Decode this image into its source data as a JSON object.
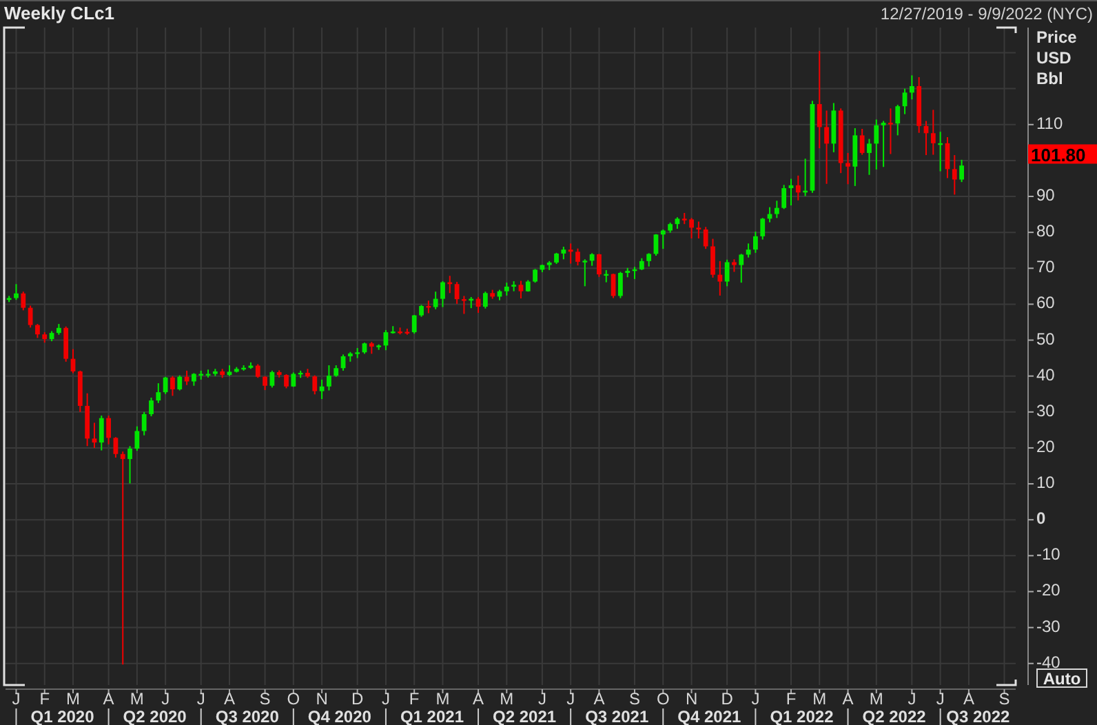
{
  "header": {
    "title": "Weekly CLc1",
    "date_range": "12/27/2019 - 9/9/2022 (NYC)"
  },
  "chart": {
    "auto_button": {
      "label": "Auto"
    },
    "quarters": [
      {
        "label": "Q1 2020"
      },
      {
        "label": "Q2 2020"
      },
      {
        "label": "Q3 2020"
      },
      {
        "label": "Q4 2020"
      },
      {
        "label": "Q1 2021"
      },
      {
        "label": "Q2 2021"
      },
      {
        "label": "Q3 2021"
      },
      {
        "label": "Q4 2021"
      },
      {
        "label": "Q1 2022"
      },
      {
        "label": "Q2 2022"
      },
      {
        "label": "Q3 2022"
      }
    ],
    "chart_data": {
      "type": "candlestick",
      "ylabel": "Price USD Bbl",
      "grid": true,
      "ylim": [
        -46,
        137
      ],
      "yticks": [
        {
          "value": -40,
          "label": "-40"
        },
        {
          "value": -30,
          "label": "-30"
        },
        {
          "value": -20,
          "label": "-20"
        },
        {
          "value": -10,
          "label": "-10"
        },
        {
          "value": 0,
          "label": "0"
        },
        {
          "value": 10,
          "label": "10"
        },
        {
          "value": 20,
          "label": "20"
        },
        {
          "value": 30,
          "label": "30"
        },
        {
          "value": 40,
          "label": "40"
        },
        {
          "value": 50,
          "label": "50"
        },
        {
          "value": 60,
          "label": "60"
        },
        {
          "value": 70,
          "label": "70"
        },
        {
          "value": 80,
          "label": "80"
        },
        {
          "value": 90,
          "label": "90"
        },
        {
          "value": 110,
          "label": "110"
        }
      ],
      "annotations": [
        "101.80"
      ],
      "categories": [
        null,
        "J",
        null,
        null,
        null,
        "F",
        null,
        null,
        null,
        "M",
        null,
        null,
        null,
        null,
        "A",
        null,
        null,
        null,
        "M",
        null,
        null,
        null,
        "J",
        null,
        null,
        null,
        null,
        "J",
        null,
        null,
        null,
        "A",
        null,
        null,
        null,
        null,
        "S",
        null,
        null,
        null,
        "O",
        null,
        null,
        null,
        "N",
        null,
        null,
        null,
        null,
        "D",
        null,
        null,
        null,
        "J",
        null,
        null,
        null,
        "F",
        null,
        null,
        null,
        "M",
        null,
        null,
        null,
        null,
        "A",
        null,
        null,
        null,
        "M",
        null,
        null,
        null,
        null,
        "J",
        null,
        null,
        null,
        "J",
        null,
        null,
        null,
        "A",
        null,
        null,
        null,
        null,
        "S",
        null,
        null,
        null,
        "O",
        null,
        null,
        null,
        "N",
        null,
        null,
        null,
        null,
        "D",
        null,
        null,
        null,
        "J",
        null,
        null,
        null,
        null,
        "F",
        null,
        null,
        null,
        "M",
        null,
        null,
        null,
        "A",
        null,
        null,
        null,
        "M",
        null,
        null,
        null,
        null,
        "J",
        null,
        null,
        null,
        "J",
        null,
        null,
        null,
        "A",
        null,
        null,
        null,
        null,
        "S",
        null
      ],
      "ohlc": [
        [
          61.2,
          62.3,
          60.6,
          61.7
        ],
        [
          61.7,
          65.6,
          61.2,
          63.0
        ],
        [
          63.0,
          63.5,
          58.3,
          59.0
        ],
        [
          59.0,
          59.6,
          53.5,
          54.2
        ],
        [
          54.2,
          54.5,
          50.6,
          51.6
        ],
        [
          51.6,
          52.2,
          49.3,
          50.3
        ],
        [
          50.3,
          52.5,
          49.7,
          52.0
        ],
        [
          52.0,
          54.5,
          51.5,
          53.4
        ],
        [
          53.4,
          53.8,
          44.0,
          44.8
        ],
        [
          44.8,
          47.5,
          40.8,
          41.3
        ],
        [
          41.3,
          41.5,
          30.0,
          31.7
        ],
        [
          31.7,
          35.2,
          20.5,
          22.6
        ],
        [
          22.6,
          27.0,
          20.0,
          21.5
        ],
        [
          21.5,
          29.0,
          19.3,
          28.3
        ],
        [
          28.3,
          29.0,
          21.0,
          22.8
        ],
        [
          22.8,
          23.0,
          17.3,
          18.3
        ],
        [
          18.3,
          19.0,
          -40.3,
          16.9
        ],
        [
          16.9,
          20.5,
          10.1,
          19.8
        ],
        [
          19.8,
          26.0,
          19.2,
          24.7
        ],
        [
          24.7,
          30.0,
          23.5,
          29.4
        ],
        [
          29.4,
          34.0,
          28.8,
          33.2
        ],
        [
          33.2,
          38.0,
          32.5,
          35.5
        ],
        [
          35.5,
          39.8,
          35.0,
          39.6
        ],
        [
          39.6,
          40.0,
          34.5,
          36.3
        ],
        [
          36.3,
          40.2,
          36.0,
          39.8
        ],
        [
          39.8,
          41.5,
          37.5,
          38.5
        ],
        [
          38.5,
          40.8,
          37.3,
          40.6
        ],
        [
          40.6,
          41.5,
          39.0,
          40.6
        ],
        [
          40.6,
          41.8,
          39.6,
          40.6
        ],
        [
          40.6,
          42.0,
          40.0,
          41.3
        ],
        [
          41.3,
          42.0,
          39.5,
          40.3
        ],
        [
          40.3,
          43.0,
          40.0,
          41.2
        ],
        [
          41.2,
          42.5,
          41.0,
          42.0
        ],
        [
          42.0,
          43.0,
          41.5,
          42.3
        ],
        [
          42.3,
          43.8,
          42.0,
          42.9
        ],
        [
          42.9,
          43.3,
          39.5,
          39.8
        ],
        [
          39.8,
          40.0,
          36.1,
          37.3
        ],
        [
          37.3,
          41.5,
          36.8,
          41.1
        ],
        [
          41.1,
          41.6,
          39.6,
          40.3
        ],
        [
          40.3,
          40.5,
          36.6,
          37.1
        ],
        [
          37.1,
          41.0,
          37.0,
          40.6
        ],
        [
          40.6,
          41.5,
          39.5,
          40.9
        ],
        [
          40.9,
          42.0,
          39.5,
          39.9
        ],
        [
          39.9,
          40.2,
          34.9,
          35.8
        ],
        [
          35.8,
          39.0,
          33.6,
          37.1
        ],
        [
          37.1,
          43.0,
          36.0,
          40.1
        ],
        [
          40.1,
          43.0,
          39.8,
          42.2
        ],
        [
          42.2,
          46.0,
          41.5,
          45.5
        ],
        [
          45.5,
          46.7,
          44.0,
          46.3
        ],
        [
          46.3,
          47.8,
          45.0,
          46.6
        ],
        [
          46.6,
          49.3,
          46.2,
          49.1
        ],
        [
          49.1,
          49.5,
          46.2,
          48.2
        ],
        [
          48.2,
          48.8,
          47.3,
          48.5
        ],
        [
          48.5,
          52.8,
          47.2,
          52.2
        ],
        [
          52.2,
          53.9,
          51.8,
          52.4
        ],
        [
          52.4,
          53.5,
          51.6,
          52.3
        ],
        [
          52.3,
          53.2,
          51.5,
          52.2
        ],
        [
          52.2,
          57.0,
          51.8,
          56.9
        ],
        [
          56.9,
          59.8,
          56.5,
          59.5
        ],
        [
          59.5,
          61.0,
          57.5,
          59.2
        ],
        [
          59.2,
          63.5,
          58.6,
          61.5
        ],
        [
          61.5,
          66.4,
          59.2,
          66.1
        ],
        [
          66.1,
          67.9,
          63.1,
          65.6
        ],
        [
          65.6,
          66.2,
          60.1,
          61.4
        ],
        [
          61.4,
          62.3,
          57.3,
          61.0
        ],
        [
          61.0,
          62.0,
          58.9,
          61.5
        ],
        [
          61.5,
          62.0,
          57.6,
          59.3
        ],
        [
          59.3,
          63.5,
          58.8,
          63.1
        ],
        [
          63.1,
          64.0,
          61.5,
          62.1
        ],
        [
          62.1,
          64.0,
          61.1,
          63.6
        ],
        [
          63.6,
          66.0,
          62.4,
          64.9
        ],
        [
          64.9,
          66.4,
          63.6,
          65.4
        ],
        [
          65.4,
          66.5,
          61.6,
          63.6
        ],
        [
          63.6,
          66.7,
          63.5,
          66.3
        ],
        [
          66.3,
          69.8,
          66.0,
          69.6
        ],
        [
          69.6,
          71.0,
          68.9,
          70.9
        ],
        [
          70.9,
          72.0,
          69.5,
          71.6
        ],
        [
          71.6,
          74.3,
          71.2,
          74.1
        ],
        [
          74.1,
          76.0,
          72.5,
          75.2
        ],
        [
          75.2,
          76.9,
          71.3,
          74.6
        ],
        [
          74.6,
          75.5,
          70.8,
          71.8
        ],
        [
          71.8,
          72.5,
          65.0,
          72.1
        ],
        [
          72.1,
          74.2,
          70.7,
          73.9
        ],
        [
          73.9,
          74.0,
          67.6,
          68.3
        ],
        [
          68.3,
          69.5,
          66.1,
          68.4
        ],
        [
          68.4,
          68.5,
          61.7,
          62.3
        ],
        [
          62.3,
          69.0,
          61.7,
          68.7
        ],
        [
          68.7,
          70.1,
          67.5,
          69.3
        ],
        [
          69.3,
          70.4,
          67.0,
          69.7
        ],
        [
          69.7,
          72.8,
          69.5,
          72.0
        ],
        [
          72.0,
          74.2,
          70.5,
          74.0
        ],
        [
          74.0,
          79.5,
          73.5,
          79.4
        ],
        [
          79.4,
          80.8,
          75.4,
          80.5
        ],
        [
          80.5,
          82.7,
          79.9,
          82.3
        ],
        [
          82.3,
          84.2,
          81.0,
          83.8
        ],
        [
          83.8,
          85.4,
          82.3,
          83.6
        ],
        [
          83.6,
          84.0,
          78.3,
          81.3
        ],
        [
          81.3,
          83.0,
          78.3,
          80.8
        ],
        [
          80.8,
          81.5,
          75.4,
          76.1
        ],
        [
          76.1,
          78.2,
          67.4,
          68.2
        ],
        [
          68.2,
          72.0,
          62.4,
          66.3
        ],
        [
          66.3,
          72.4,
          65.0,
          71.7
        ],
        [
          71.7,
          72.5,
          69.0,
          70.9
        ],
        [
          70.9,
          74.0,
          66.0,
          73.8
        ],
        [
          73.8,
          76.9,
          73.0,
          75.2
        ],
        [
          75.2,
          80.2,
          74.3,
          78.9
        ],
        [
          78.9,
          84.0,
          78.0,
          83.8
        ],
        [
          83.8,
          87.0,
          82.8,
          85.1
        ],
        [
          85.1,
          88.8,
          84.0,
          86.8
        ],
        [
          86.8,
          93.2,
          86.5,
          92.3
        ],
        [
          92.3,
          94.9,
          87.5,
          93.1
        ],
        [
          93.1,
          95.8,
          88.9,
          91.1
        ],
        [
          91.1,
          100.5,
          90.1,
          91.6
        ],
        [
          91.6,
          116.6,
          91.0,
          115.7
        ],
        [
          115.7,
          130.5,
          103.4,
          109.3
        ],
        [
          109.3,
          113.9,
          93.5,
          104.7
        ],
        [
          104.7,
          116.0,
          102.3,
          113.9
        ],
        [
          113.9,
          114.5,
          96.5,
          99.3
        ],
        [
          99.3,
          102.1,
          93.4,
          98.3
        ],
        [
          98.3,
          109.0,
          92.9,
          107.0
        ],
        [
          107.0,
          108.8,
          101.6,
          102.1
        ],
        [
          102.1,
          106.0,
          96.0,
          104.7
        ],
        [
          104.7,
          111.4,
          97.5,
          109.8
        ],
        [
          109.8,
          111.0,
          98.2,
          110.5
        ],
        [
          110.5,
          114.5,
          101.8,
          110.3
        ],
        [
          110.3,
          115.5,
          107.0,
          115.1
        ],
        [
          115.1,
          120.0,
          112.9,
          118.9
        ],
        [
          118.9,
          123.7,
          117.0,
          120.7
        ],
        [
          120.7,
          123.2,
          107.7,
          109.6
        ],
        [
          109.6,
          111.0,
          101.5,
          107.6
        ],
        [
          107.6,
          114.1,
          101.6,
          104.8
        ],
        [
          104.8,
          108.0,
          97.0,
          104.8
        ],
        [
          104.8,
          106.5,
          95.1,
          97.6
        ],
        [
          97.6,
          101.5,
          90.5,
          94.7
        ],
        [
          94.7,
          100.2,
          94.0,
          98.6
        ],
        null,
        null,
        null,
        null,
        null,
        null,
        null
      ]
    }
  }
}
